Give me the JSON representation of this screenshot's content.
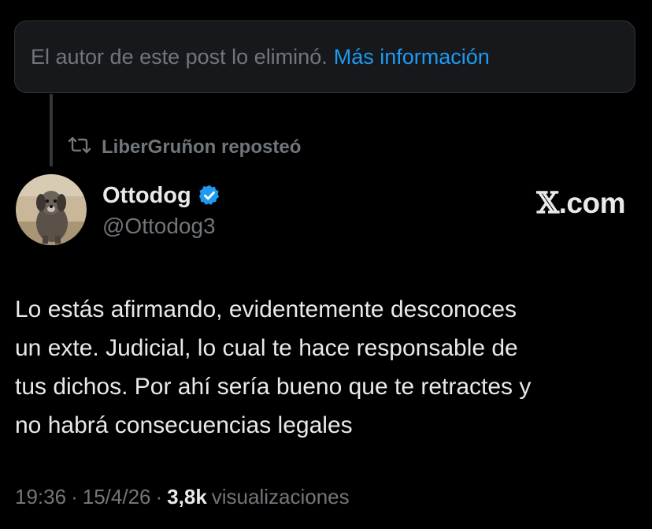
{
  "deleted_notice": {
    "text": "El autor de este post lo eliminó.",
    "link_label": "Más información"
  },
  "repost": {
    "icon": "repost-icon",
    "label": "LiberGruñon reposteó"
  },
  "author": {
    "display_name": "Ottodog",
    "handle": "@Ottodog3",
    "verified_icon": "verified-badge-icon",
    "avatar_icon": "dog-avatar"
  },
  "watermark": {
    "x": "𝕏",
    "domain": ".com"
  },
  "post": {
    "lines": [
      "Lo estás afirmando, evidentemente desconoces",
      "un exte. Judicial, lo cual te hace responsable de",
      "tus dichos. Por ahí sería bueno que te retractes y",
      "no habrá consecuencias legales"
    ]
  },
  "meta": {
    "time": "19:36",
    "sep1": "·",
    "date": "15/4/26",
    "sep2": "·",
    "views_count": "3,8k",
    "views_label": "visualizaciones"
  },
  "colors": {
    "background": "#000000",
    "text": "#e7e9ea",
    "muted": "#71767b",
    "link": "#1d9bf0"
  }
}
